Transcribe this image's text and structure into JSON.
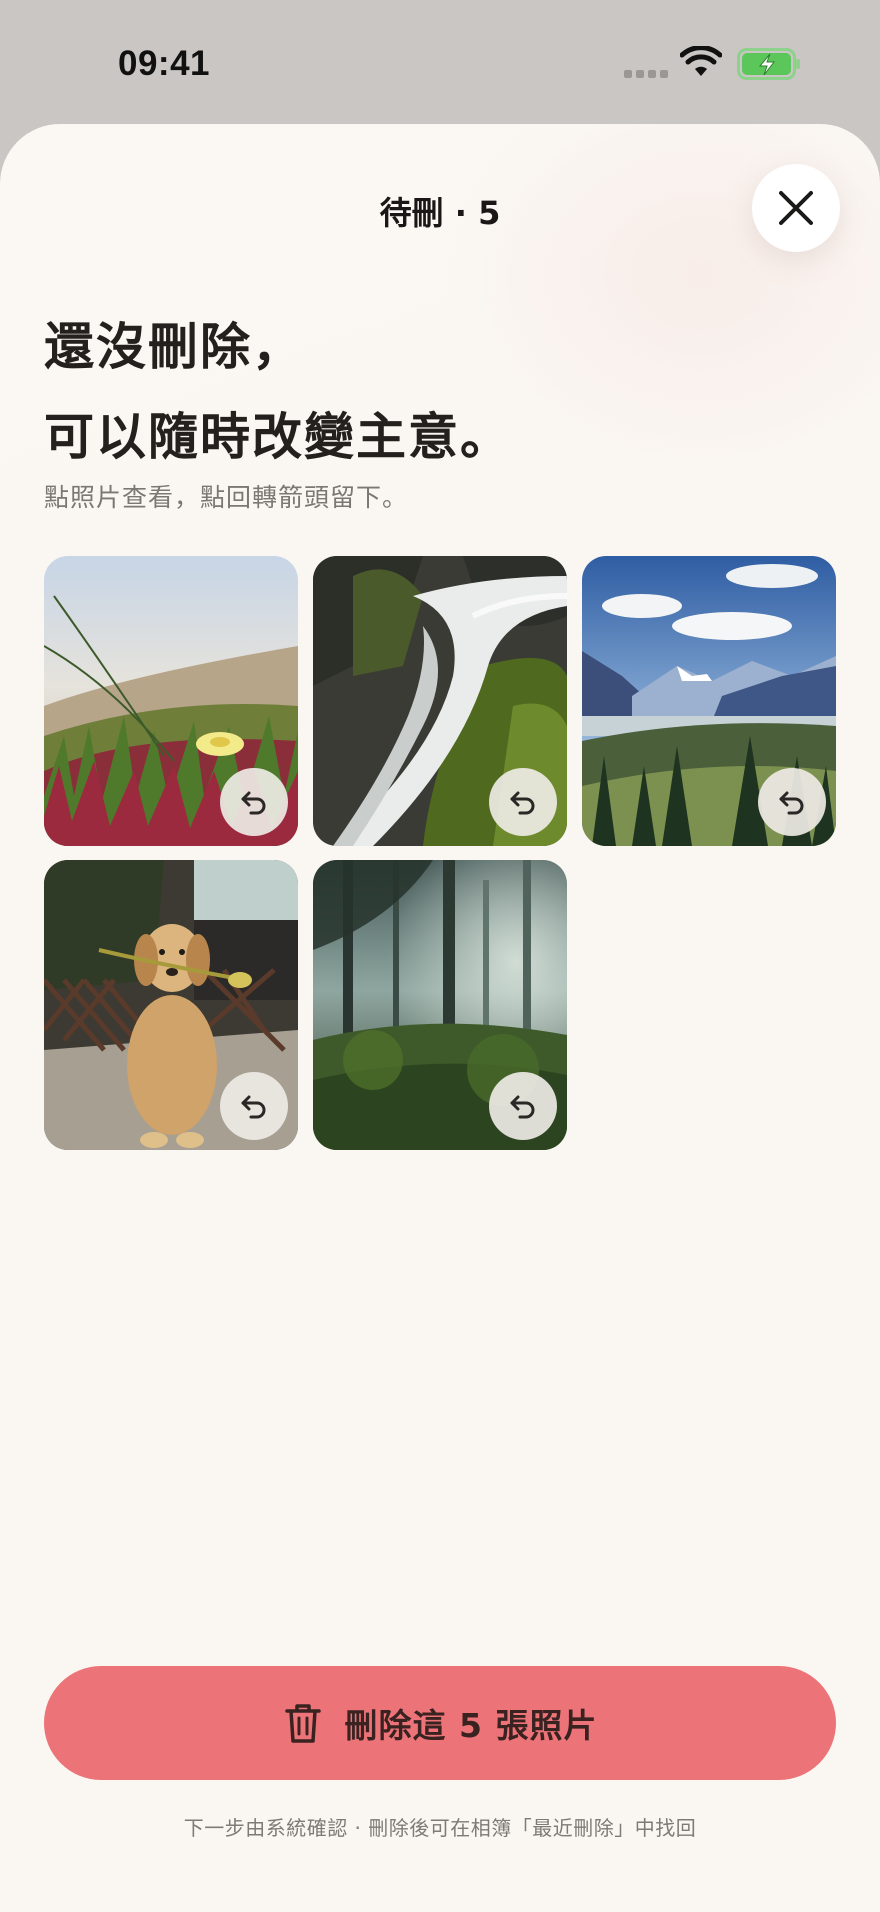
{
  "status_bar": {
    "time": "09:41"
  },
  "sheet": {
    "title": "待刪 · 5",
    "headline_line1": "還沒刪除，",
    "headline_line2": "可以隨時改變主意。",
    "subtitle": "點照片查看，點回轉箭頭留下。"
  },
  "photos": [
    {
      "subject": "ice plant flower on dunes",
      "icon": "undo-arrow-icon"
    },
    {
      "subject": "waterfall over mossy rocks",
      "icon": "undo-arrow-icon"
    },
    {
      "subject": "mountain valley with pine trees",
      "icon": "undo-arrow-icon"
    },
    {
      "subject": "golden retriever holding a flower",
      "icon": "undo-arrow-icon"
    },
    {
      "subject": "misty forest",
      "icon": "undo-arrow-icon"
    }
  ],
  "actions": {
    "delete_label": "刪除這 5 張照片",
    "footnote": "下一步由系統確認 · 刪除後可在相簿「最近刪除」中找回"
  },
  "colors": {
    "accent": "#ec7478",
    "sheet_background": "#faf7f3",
    "battery": "#5bc75a"
  }
}
